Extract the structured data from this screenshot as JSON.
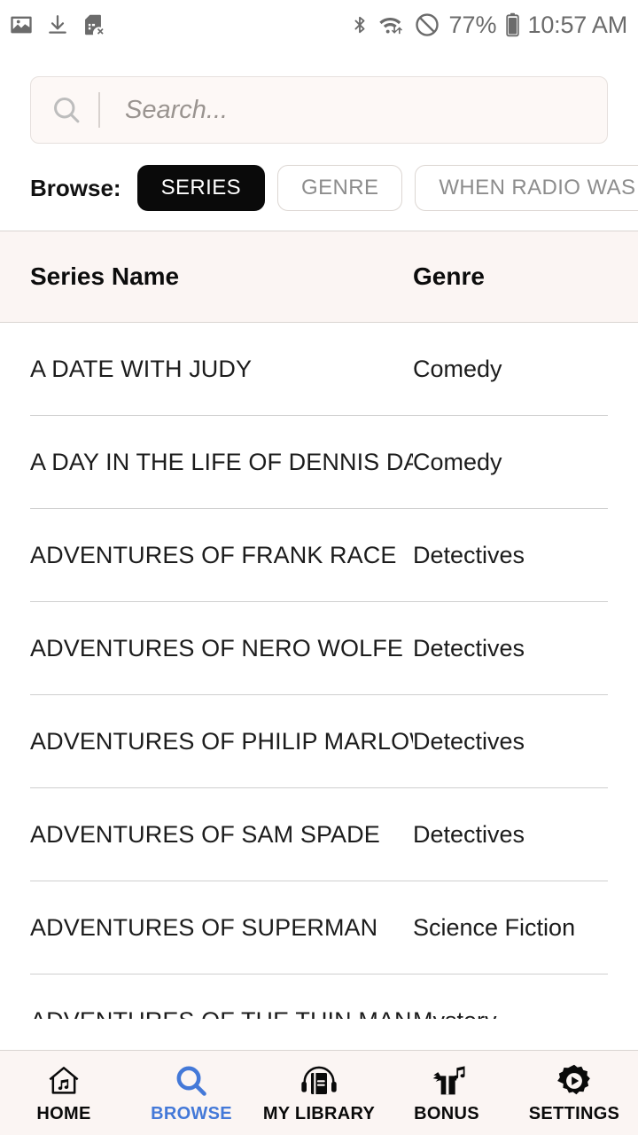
{
  "status_bar": {
    "left_icons": [
      "image-icon",
      "download-icon",
      "sim-card-error-icon"
    ],
    "right_icons": [
      "bluetooth-icon",
      "wifi-transfer-icon",
      "do-not-disturb-icon",
      "battery-icon"
    ],
    "battery_percent": "77%",
    "time": "10:57 AM"
  },
  "search": {
    "placeholder": "Search...",
    "value": "",
    "icon": "search-icon"
  },
  "browse": {
    "label": "Browse:",
    "chips": [
      {
        "label": "SERIES",
        "active": true
      },
      {
        "label": "GENRE",
        "active": false
      },
      {
        "label": "WHEN RADIO WAS",
        "active": false
      }
    ]
  },
  "table": {
    "columns": [
      "Series Name",
      "Genre"
    ],
    "rows": [
      {
        "name": "A DATE WITH JUDY",
        "genre": "Comedy"
      },
      {
        "name": "A DAY IN THE LIFE OF DENNIS DAY",
        "genre": "Comedy"
      },
      {
        "name": "ADVENTURES OF FRANK RACE",
        "genre": "Detectives"
      },
      {
        "name": "ADVENTURES OF NERO WOLFE",
        "genre": "Detectives"
      },
      {
        "name": "ADVENTURES OF PHILIP MARLOWE",
        "genre": "Detectives"
      },
      {
        "name": "ADVENTURES OF SAM SPADE",
        "genre": "Detectives"
      },
      {
        "name": "ADVENTURES OF SUPERMAN",
        "genre": "Science Fiction"
      },
      {
        "name": "ADVENTURES OF THE THIN MAN",
        "genre": "Mystery"
      }
    ]
  },
  "bottom_nav": {
    "items": [
      {
        "label": "HOME",
        "icon": "home-music-icon",
        "active": false
      },
      {
        "label": "BROWSE",
        "icon": "search-icon",
        "active": true
      },
      {
        "label": "MY LIBRARY",
        "icon": "book-headphones-icon",
        "active": false
      },
      {
        "label": "BONUS",
        "icon": "gift-music-icon",
        "active": false
      },
      {
        "label": "SETTINGS",
        "icon": "gear-play-icon",
        "active": false
      }
    ]
  },
  "colors": {
    "accent_blue": "#4479d8",
    "chip_active_bg": "#0a0a0a",
    "header_bg": "#fbf5f3",
    "page_bg": "#ffffff",
    "divider": "#cfcfcf"
  }
}
